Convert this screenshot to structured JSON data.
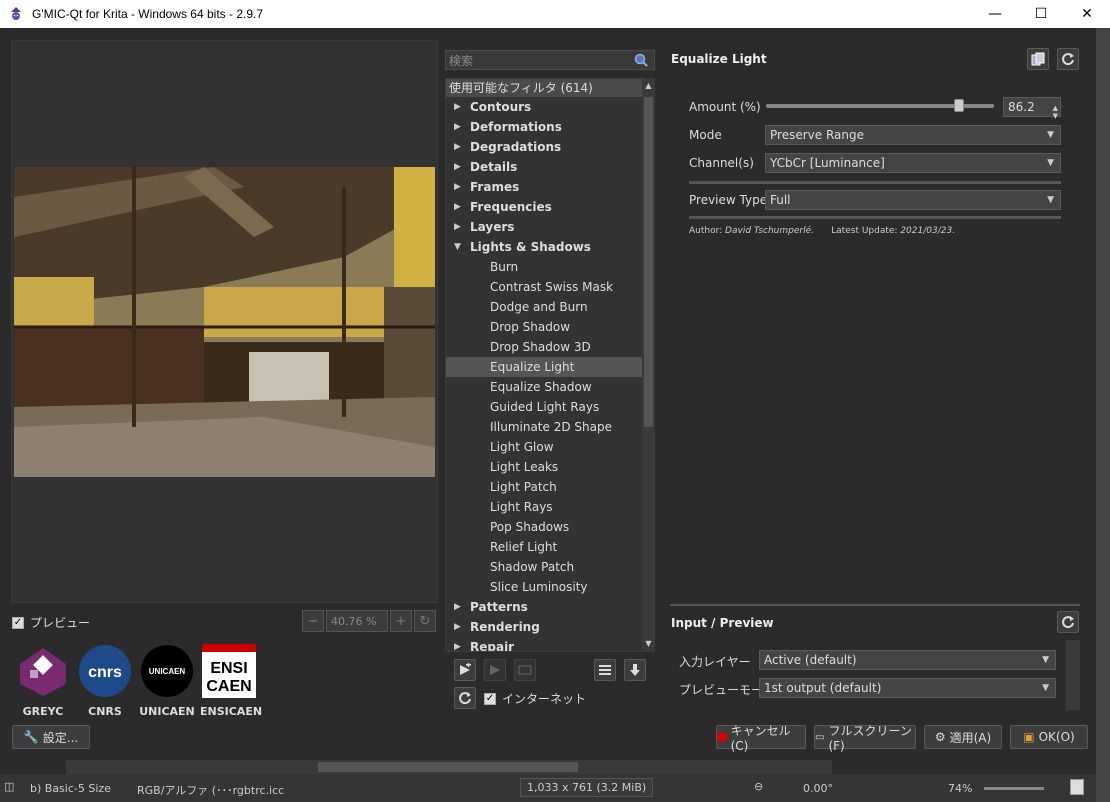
{
  "window": {
    "title": "G'MIC-Qt for Krita - Windows 64 bits - 2.9.7",
    "minimize": "—",
    "maximize": "☐",
    "close": "✕"
  },
  "preview": {
    "checkbox_label": "プレビュー",
    "check_mark": "✓",
    "zoom_value": "40.76 %"
  },
  "logos": [
    {
      "label": "GREYC"
    },
    {
      "label": "CNRS",
      "text": "cnrs"
    },
    {
      "label": "UNICAEN",
      "text": "UNICAEN"
    },
    {
      "label": "ENSICAEN",
      "text1": "ENSI",
      "text2": "CAEN"
    }
  ],
  "settings_button": "設定...",
  "search": {
    "placeholder": "検索"
  },
  "tree": {
    "header": "使用可能なフィルタ (614)",
    "items": [
      {
        "label": "Contours",
        "type": "cat",
        "arrow": "▶"
      },
      {
        "label": "Deformations",
        "type": "cat",
        "arrow": "▶"
      },
      {
        "label": "Degradations",
        "type": "cat",
        "arrow": "▶"
      },
      {
        "label": "Details",
        "type": "cat",
        "arrow": "▶"
      },
      {
        "label": "Frames",
        "type": "cat",
        "arrow": "▶"
      },
      {
        "label": "Frequencies",
        "type": "cat",
        "arrow": "▶"
      },
      {
        "label": "Layers",
        "type": "cat",
        "arrow": "▶"
      },
      {
        "label": "Lights & Shadows",
        "type": "cat",
        "arrow": "▼"
      },
      {
        "label": "Burn",
        "type": "leaf"
      },
      {
        "label": "Contrast Swiss Mask",
        "type": "leaf"
      },
      {
        "label": "Dodge and Burn",
        "type": "leaf"
      },
      {
        "label": "Drop Shadow",
        "type": "leaf"
      },
      {
        "label": "Drop Shadow 3D",
        "type": "leaf"
      },
      {
        "label": "Equalize Light",
        "type": "leaf",
        "selected": true
      },
      {
        "label": "Equalize Shadow",
        "type": "leaf"
      },
      {
        "label": "Guided Light Rays",
        "type": "leaf"
      },
      {
        "label": "Illuminate 2D Shape",
        "type": "leaf"
      },
      {
        "label": "Light Glow",
        "type": "leaf"
      },
      {
        "label": "Light Leaks",
        "type": "leaf"
      },
      {
        "label": "Light Patch",
        "type": "leaf"
      },
      {
        "label": "Light Rays",
        "type": "leaf"
      },
      {
        "label": "Pop Shadows",
        "type": "leaf"
      },
      {
        "label": "Relief Light",
        "type": "leaf"
      },
      {
        "label": "Shadow Patch",
        "type": "leaf"
      },
      {
        "label": "Slice Luminosity",
        "type": "leaf"
      },
      {
        "label": "Patterns",
        "type": "cat",
        "arrow": "▶"
      },
      {
        "label": "Rendering",
        "type": "cat",
        "arrow": "▶"
      },
      {
        "label": "Repair",
        "type": "cat",
        "arrow": "▶"
      }
    ]
  },
  "internet_checkbox": "インターネット",
  "filter": {
    "title": "Equalize Light",
    "amount_label": "Amount (%)",
    "amount_value": "86.2",
    "amount_fraction": 0.862,
    "mode_label": "Mode",
    "mode_value": "Preserve Range",
    "channels_label": "Channel(s)",
    "channels_value": "YCbCr [Luminance]",
    "preview_type_label": "Preview Type",
    "preview_type_value": "Full",
    "author_prefix": "Author: ",
    "author_name": "David Tschumperlé.",
    "update_prefix": "Latest Update: ",
    "update_date": "2021/03/23."
  },
  "input_preview": {
    "title": "Input / Preview",
    "input_layer_label": "入力レイヤー",
    "input_layer_value": "Active (default)",
    "preview_mode_label": "プレビューモード",
    "preview_mode_value": "1st output (default)"
  },
  "buttons": {
    "cancel": "キャンセル(C)",
    "fullscreen": "フルスクリーン(F)",
    "apply": "適用(A)",
    "ok": "OK(O)"
  },
  "statusbar": {
    "brush": "b) Basic-5 Size",
    "colorspace": "RGB/アルファ (･･･rgbtrc.icc",
    "dimensions": "1,033 x 761 (3.2 MiB)",
    "rotation": "0.00°",
    "zoom": "74%"
  },
  "colors": {
    "accent_red": "#e00000",
    "panel": "#2b2b2b",
    "selection": "#555555"
  }
}
